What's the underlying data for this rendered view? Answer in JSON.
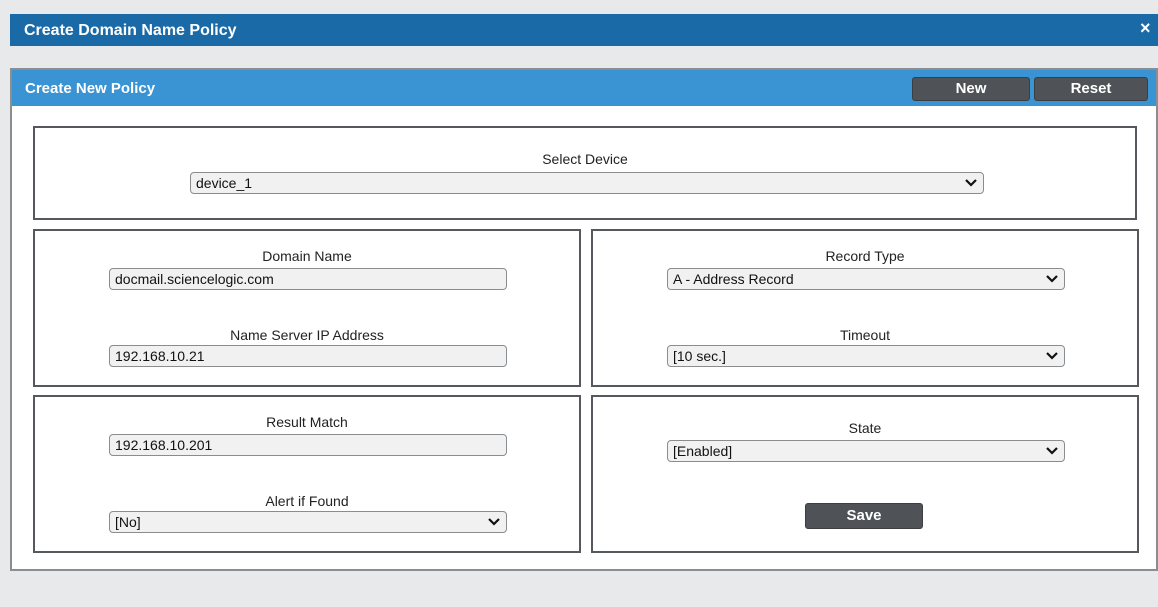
{
  "dialog": {
    "title": "Create Domain Name Policy",
    "close_glyph": "×"
  },
  "panel": {
    "title": "Create New Policy",
    "new_label": "New",
    "reset_label": "Reset"
  },
  "form": {
    "select_device": {
      "label": "Select Device",
      "value": "device_1"
    },
    "domain_name": {
      "label": "Domain Name",
      "value": "docmail.sciencelogic.com"
    },
    "name_server_ip": {
      "label": "Name Server IP Address",
      "value": "192.168.10.21"
    },
    "record_type": {
      "label": "Record Type",
      "value": "A - Address Record"
    },
    "timeout": {
      "label": "Timeout",
      "value": "[10 sec.]"
    },
    "result_match": {
      "label": "Result Match",
      "value": "192.168.10.201"
    },
    "alert_if_found": {
      "label": "Alert if Found",
      "value": "[No]"
    },
    "state": {
      "label": "State",
      "value": "[Enabled]"
    },
    "save_label": "Save"
  },
  "colors": {
    "titlebar": "#1b6aa8",
    "panel_header": "#3a94d3",
    "button": "#4f5357"
  },
  "icons": {
    "dropdown": "chevron-down-icon",
    "close": "close-icon"
  }
}
